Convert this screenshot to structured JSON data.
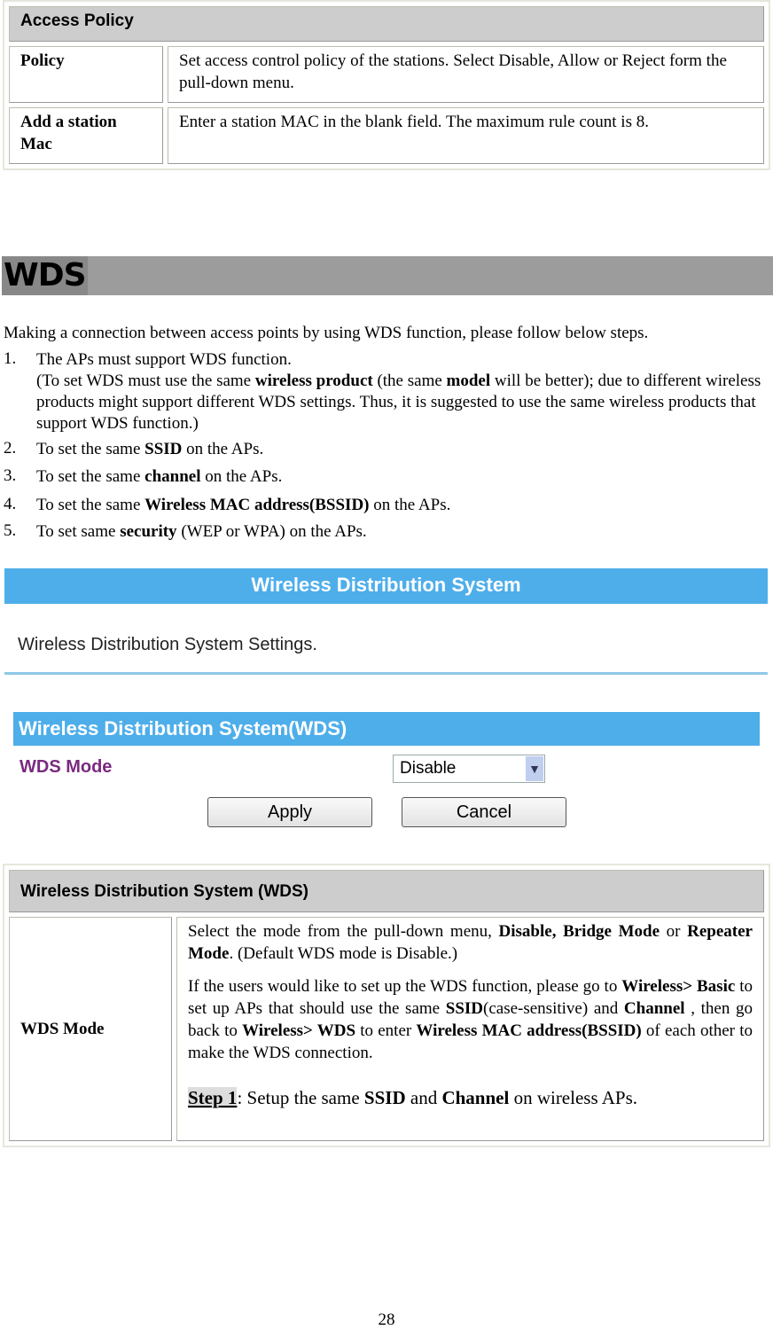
{
  "access_policy": {
    "title": "Access Policy",
    "rows": [
      {
        "label": "Policy",
        "desc": "Set access control policy of the stations. Select Disable, Allow or Reject form the pull-down menu."
      },
      {
        "label": "Add a station Mac",
        "desc": "Enter a station MAC in the blank field. The maximum rule count is 8."
      }
    ]
  },
  "section_title": "WDS",
  "intro": "Making a connection between access points by using WDS function, please follow below steps.",
  "steps": [
    {
      "num": "1.",
      "segs": [
        {
          "t": "The APs must support WDS function."
        },
        {
          "br": true
        },
        {
          "t": "(To set WDS must use the same "
        },
        {
          "t": "wireless product",
          "b": true
        },
        {
          "t": " (the same "
        },
        {
          "t": "model",
          "b": true
        },
        {
          "t": " will be better); due to different wireless products might support different WDS settings. Thus, it is suggested to use the same wireless products that support WDS function.)"
        }
      ]
    },
    {
      "num": "2.",
      "segs": [
        {
          "t": "To set the same "
        },
        {
          "t": "SSID",
          "b": true
        },
        {
          "t": " on the APs."
        }
      ]
    },
    {
      "num": "3.",
      "segs": [
        {
          "t": "To set the same "
        },
        {
          "t": "channel",
          "b": true
        },
        {
          "t": " on the APs."
        }
      ]
    },
    {
      "num": "4.",
      "segs": [
        {
          "t": "To set the same "
        },
        {
          "t": "Wireless MAC address(BSSID)",
          "b": true
        },
        {
          "t": " on the APs."
        }
      ]
    },
    {
      "num": "5.",
      "segs": [
        {
          "t": "To set same "
        },
        {
          "t": "security",
          "b": true
        },
        {
          "t": " (WEP or WPA) on the APs."
        }
      ]
    }
  ],
  "screenshot": {
    "banner": "Wireless Distribution System",
    "subtitle": "Wireless Distribution System Settings.",
    "section_bar": "Wireless Distribution System(WDS)",
    "mode_label": "WDS Mode",
    "mode_value": "Disable",
    "apply": "Apply",
    "cancel": "Cancel",
    "accent": "#4eaeea"
  },
  "wds_table": {
    "title": "Wireless Distribution System (WDS)",
    "label": "WDS Mode",
    "p1": [
      {
        "t": "Select the mode from the pull-down menu, "
      },
      {
        "t": "Disable, Bridge Mode",
        "b": true
      },
      {
        "t": " or "
      },
      {
        "t": "Repeater Mode",
        "b": true
      },
      {
        "t": ". (Default WDS mode is Disable.)"
      }
    ],
    "p2": [
      {
        "t": "If the users would like to set up the WDS function, please go to "
      },
      {
        "t": "Wireless> Basic",
        "b": true
      },
      {
        "t": " to set up APs that should use the same "
      },
      {
        "t": "SSID",
        "b": true
      },
      {
        "t": "(case-sensitive) and "
      },
      {
        "t": "Channel",
        "b": true
      },
      {
        "t": " , then go back to "
      },
      {
        "t": "Wireless> WDS",
        "b": true
      },
      {
        "t": " to enter "
      },
      {
        "t": "Wireless MAC address(BSSID)",
        "b": true
      },
      {
        "t": " of each other to make the WDS connection."
      }
    ],
    "p3": [
      {
        "t": "Step 1",
        "u": true
      },
      {
        "t": ": Setup the same "
      },
      {
        "t": "SSID",
        "b": true
      },
      {
        "t": " and "
      },
      {
        "t": "Channel",
        "b": true
      },
      {
        "t": " on wireless APs."
      }
    ]
  },
  "page_number": "28"
}
